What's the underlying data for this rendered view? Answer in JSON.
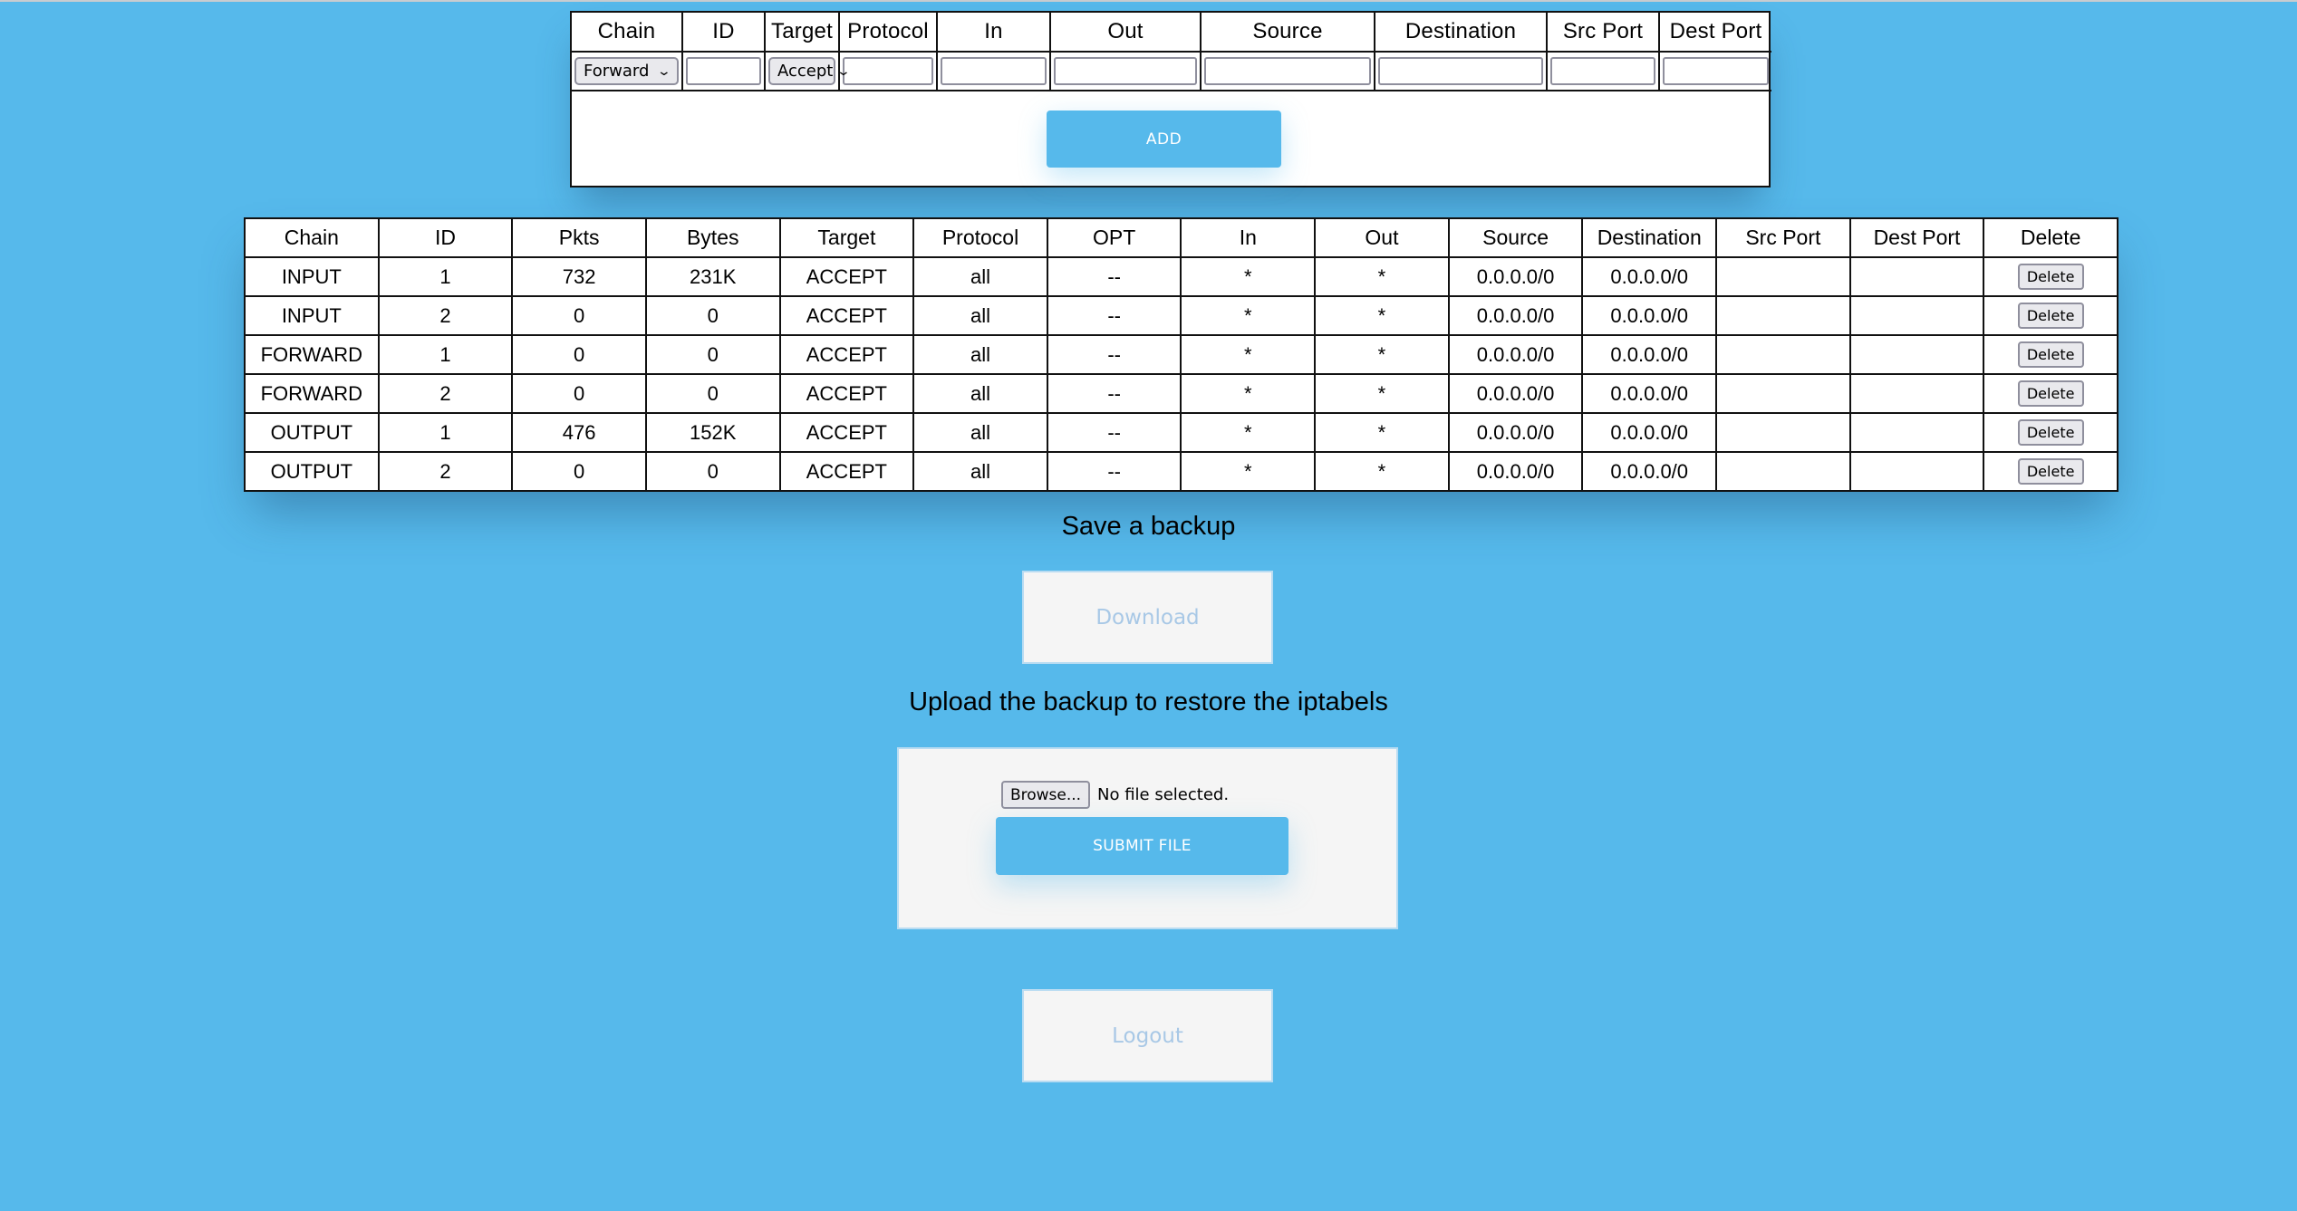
{
  "add_form": {
    "headers": [
      "Chain",
      "ID",
      "Target",
      "Protocol",
      "In",
      "Out",
      "Source",
      "Destination",
      "Src Port",
      "Dest Port"
    ],
    "chain_select": "Forward",
    "target_select": "Accept",
    "inputs": {
      "id": "",
      "protocol": "",
      "in": "",
      "out": "",
      "source": "",
      "destination": "",
      "src_port": "",
      "dest_port": ""
    },
    "add_label": "ADD"
  },
  "rules_table": {
    "headers": [
      "Chain",
      "ID",
      "Pkts",
      "Bytes",
      "Target",
      "Protocol",
      "OPT",
      "In",
      "Out",
      "Source",
      "Destination",
      "Src Port",
      "Dest Port",
      "Delete"
    ],
    "rows": [
      {
        "chain": "INPUT",
        "id": "1",
        "pkts": "732",
        "bytes": "231K",
        "target": "ACCEPT",
        "protocol": "all",
        "opt": "--",
        "in": "*",
        "out": "*",
        "source": "0.0.0.0/0",
        "destination": "0.0.0.0/0",
        "src_port": "",
        "dest_port": "",
        "delete_label": "Delete"
      },
      {
        "chain": "INPUT",
        "id": "2",
        "pkts": "0",
        "bytes": "0",
        "target": "ACCEPT",
        "protocol": "all",
        "opt": "--",
        "in": "*",
        "out": "*",
        "source": "0.0.0.0/0",
        "destination": "0.0.0.0/0",
        "src_port": "",
        "dest_port": "",
        "delete_label": "Delete"
      },
      {
        "chain": "FORWARD",
        "id": "1",
        "pkts": "0",
        "bytes": "0",
        "target": "ACCEPT",
        "protocol": "all",
        "opt": "--",
        "in": "*",
        "out": "*",
        "source": "0.0.0.0/0",
        "destination": "0.0.0.0/0",
        "src_port": "",
        "dest_port": "",
        "delete_label": "Delete"
      },
      {
        "chain": "FORWARD",
        "id": "2",
        "pkts": "0",
        "bytes": "0",
        "target": "ACCEPT",
        "protocol": "all",
        "opt": "--",
        "in": "*",
        "out": "*",
        "source": "0.0.0.0/0",
        "destination": "0.0.0.0/0",
        "src_port": "",
        "dest_port": "",
        "delete_label": "Delete"
      },
      {
        "chain": "OUTPUT",
        "id": "1",
        "pkts": "476",
        "bytes": "152K",
        "target": "ACCEPT",
        "protocol": "all",
        "opt": "--",
        "in": "*",
        "out": "*",
        "source": "0.0.0.0/0",
        "destination": "0.0.0.0/0",
        "src_port": "",
        "dest_port": "",
        "delete_label": "Delete"
      },
      {
        "chain": "OUTPUT",
        "id": "2",
        "pkts": "0",
        "bytes": "0",
        "target": "ACCEPT",
        "protocol": "all",
        "opt": "--",
        "in": "*",
        "out": "*",
        "source": "0.0.0.0/0",
        "destination": "0.0.0.0/0",
        "src_port": "",
        "dest_port": "",
        "delete_label": "Delete"
      }
    ]
  },
  "backup": {
    "save_heading": "Save a backup",
    "download_label": "Download",
    "upload_heading": "Upload the backup to restore the iptabels",
    "browse_label": "Browse...",
    "file_status": "No file selected.",
    "submit_label": "SUBMIT FILE"
  },
  "logout_label": "Logout",
  "colors": {
    "background": "#56b9eb",
    "accent_button": "#56b9eb",
    "muted_button_text": "#a8c8e6"
  }
}
